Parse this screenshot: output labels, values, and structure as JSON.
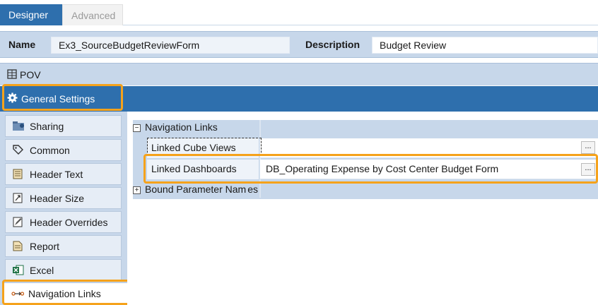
{
  "tabs": {
    "designer": "Designer",
    "advanced": "Advanced"
  },
  "header": {
    "name_label": "Name",
    "name_value": "Ex3_SourceBudgetReviewForm",
    "description_label": "Description",
    "description_value": "Budget Review"
  },
  "pov": {
    "label": "POV"
  },
  "general_settings": {
    "label": "General Settings"
  },
  "sidebar": {
    "items": [
      {
        "label": "Sharing",
        "icon": "sharing-icon"
      },
      {
        "label": "Common",
        "icon": "tag-icon"
      },
      {
        "label": "Header Text",
        "icon": "header-text-icon"
      },
      {
        "label": "Header Size",
        "icon": "header-size-icon"
      },
      {
        "label": "Header Overrides",
        "icon": "header-overrides-icon"
      },
      {
        "label": "Report",
        "icon": "report-icon"
      },
      {
        "label": "Excel",
        "icon": "excel-icon"
      },
      {
        "label": "Navigation Links",
        "icon": "navigation-links-icon"
      }
    ]
  },
  "grid": {
    "group_navigation": "Navigation Links",
    "expand_collapsed": "⊟",
    "expand_expanded": "⊞",
    "linked_cube_views_label": "Linked Cube Views",
    "linked_cube_views_value": "",
    "linked_dashboards_label": "Linked Dashboards",
    "linked_dashboards_value": "DB_Operating Expense by Cost Center Budget Form",
    "bound_parameter_names_label": "Bound Parameter Nam",
    "bound_parameter_names_suffix": "es",
    "ellipsis": "..."
  },
  "colors": {
    "accent": "#2e6fad",
    "panel": "#c7d7ea",
    "highlight": "#f5a21b"
  }
}
